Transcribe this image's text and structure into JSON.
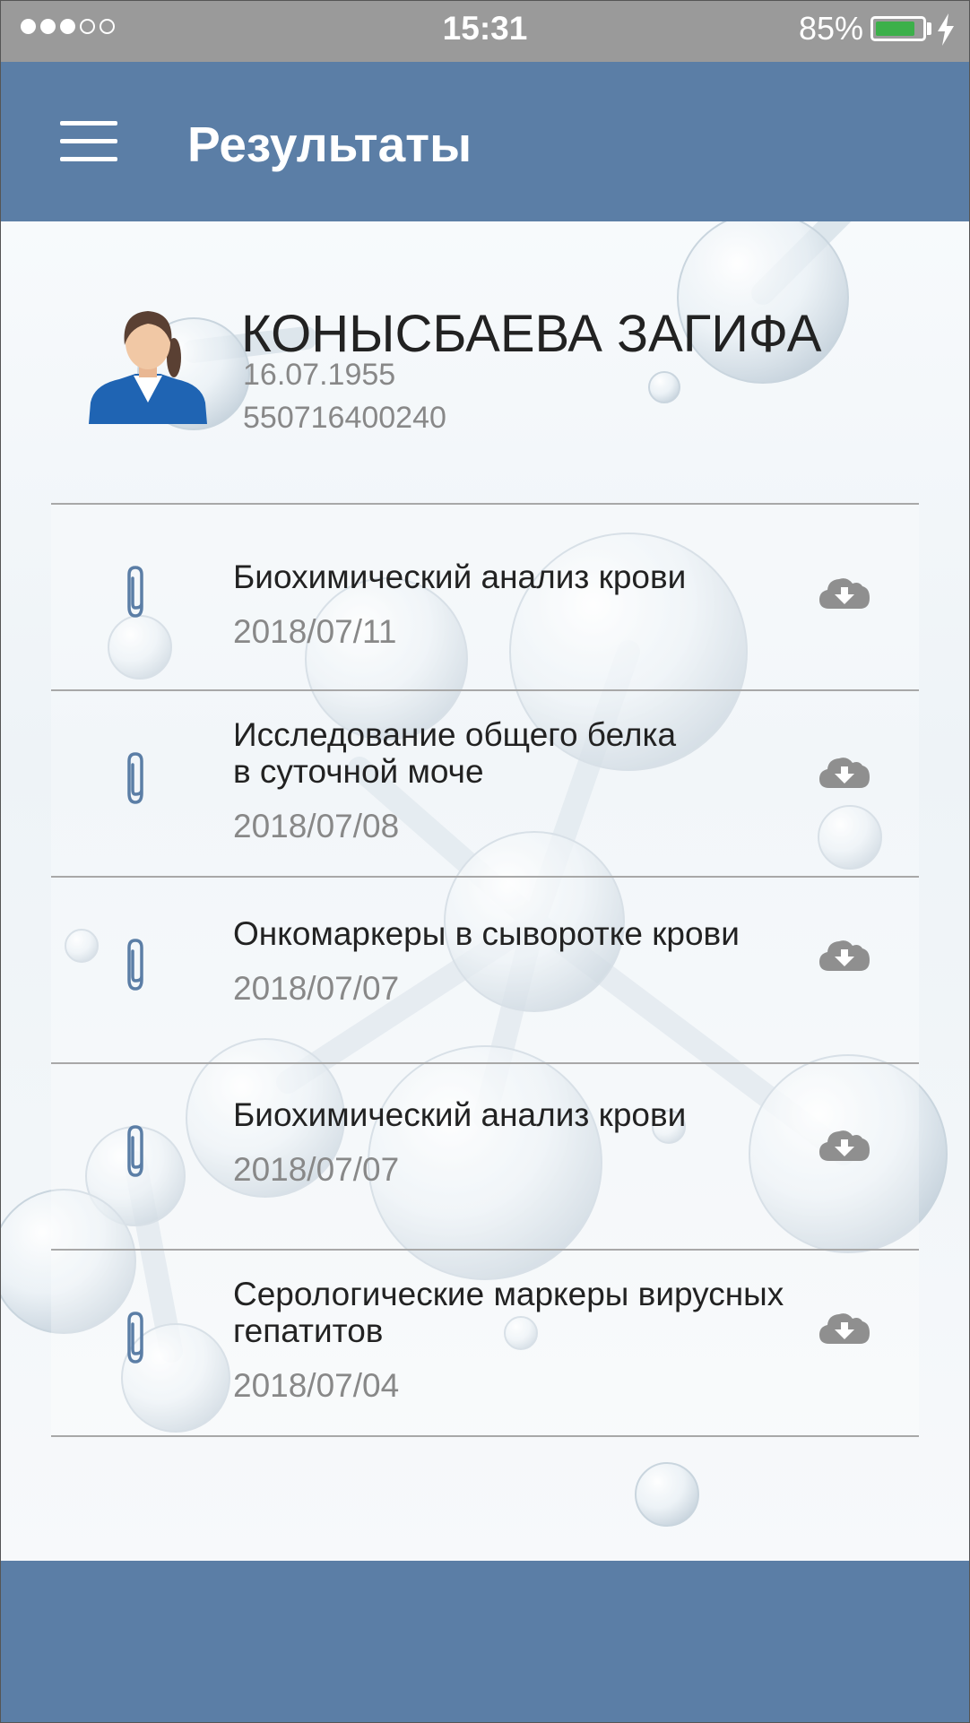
{
  "status_bar": {
    "signal": "●●●○○",
    "time": "15:31",
    "battery_percent": "85%",
    "battery_level": 0.85,
    "charging_icon": "lightning-bolt-icon"
  },
  "app_bar": {
    "menu_icon": "hamburger-menu-icon",
    "title": "Результаты"
  },
  "patient": {
    "name": "КОНЫСБАЕВА ЗАГИФА",
    "birth_date": "16.07.1955",
    "id_number": "550716400240",
    "avatar_icon": "female-user-avatar-icon"
  },
  "results": [
    {
      "title_lines": [
        "Биохимический анализ крови"
      ],
      "date": "2018/07/11"
    },
    {
      "title_lines": [
        "Исследование общего белка",
        "в суточной моче"
      ],
      "date": "2018/07/08"
    },
    {
      "title_lines": [
        "Онкомаркеры в сыворотке крови"
      ],
      "date": "2018/07/07"
    },
    {
      "title_lines": [
        "Биохимический анализ крови"
      ],
      "date": "2018/07/07"
    },
    {
      "title_lines": [
        "Серологические маркеры вирусных",
        "гепатитов"
      ],
      "date": "2018/07/04"
    }
  ],
  "row_icons": {
    "attachment": "paperclip-icon",
    "download": "cloud-download-icon"
  },
  "colors": {
    "header": "#5b7ea6",
    "status_bar": "#9a9a9a",
    "battery": "#3cb04a",
    "icon": "#5b7ea6",
    "cloud": "#8f8f8f",
    "date_text": "#888888"
  }
}
